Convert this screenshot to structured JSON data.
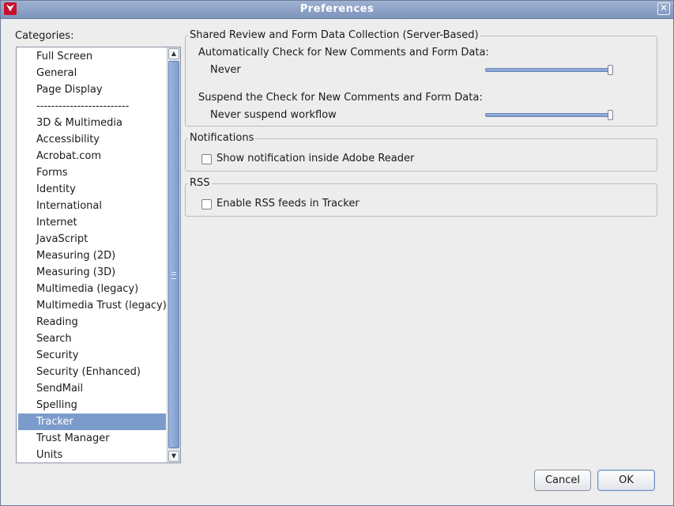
{
  "window": {
    "title": "Preferences",
    "close_glyph": "✕",
    "app_icon": "adobe-reader-icon"
  },
  "categories": {
    "label": "Categories:",
    "items": [
      {
        "label": "Full Screen"
      },
      {
        "label": "General"
      },
      {
        "label": "Page Display"
      },
      {
        "label": "-------------------------"
      },
      {
        "label": "3D & Multimedia"
      },
      {
        "label": "Accessibility"
      },
      {
        "label": "Acrobat.com"
      },
      {
        "label": "Forms"
      },
      {
        "label": "Identity"
      },
      {
        "label": "International"
      },
      {
        "label": "Internet"
      },
      {
        "label": "JavaScript"
      },
      {
        "label": "Measuring (2D)"
      },
      {
        "label": "Measuring (3D)"
      },
      {
        "label": "Multimedia (legacy)"
      },
      {
        "label": "Multimedia Trust (legacy)"
      },
      {
        "label": "Reading"
      },
      {
        "label": "Search"
      },
      {
        "label": "Security"
      },
      {
        "label": "Security (Enhanced)"
      },
      {
        "label": "SendMail"
      },
      {
        "label": "Spelling"
      },
      {
        "label": "Tracker"
      },
      {
        "label": "Trust Manager"
      },
      {
        "label": "Units"
      }
    ],
    "selected": "Tracker"
  },
  "shared_review": {
    "legend": "Shared Review and Form Data Collection (Server-Based)",
    "check_label": "Automatically Check for New Comments and Form Data:",
    "check_value": "Never",
    "check_slider_level": 1.0,
    "suspend_label": "Suspend the Check for New Comments and Form Data:",
    "suspend_value": "Never suspend workflow",
    "suspend_slider_level": 1.0
  },
  "notifications": {
    "legend": "Notifications",
    "checkbox_label": "Show notification inside Adobe Reader",
    "checked": false
  },
  "rss": {
    "legend": "RSS",
    "checkbox_label": "Enable RSS feeds in Tracker",
    "checked": false
  },
  "buttons": {
    "cancel": "Cancel",
    "ok": "OK"
  },
  "colors": {
    "selection": "#7b9ccb",
    "titlebar": "#8ba0c6",
    "accent": "#7f9ccc"
  }
}
